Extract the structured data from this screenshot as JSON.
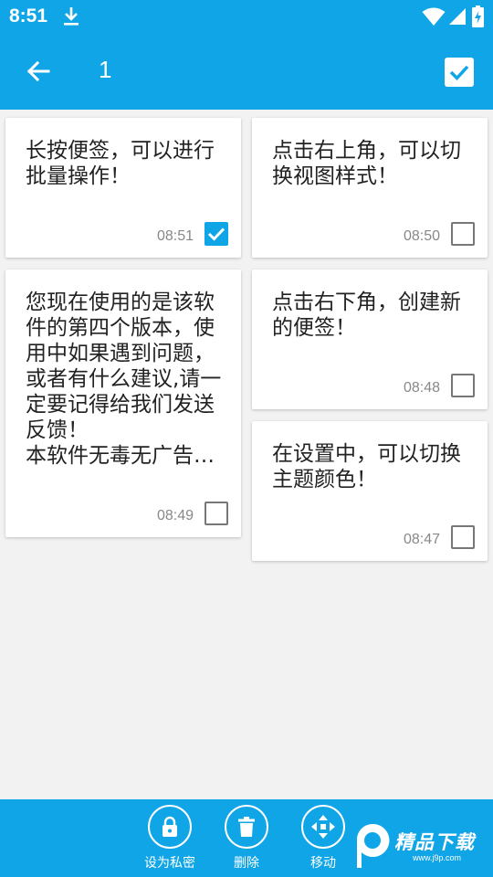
{
  "status_bar": {
    "time": "8:51"
  },
  "app_bar": {
    "selected_count": "1"
  },
  "notes": [
    {
      "text": "长按便签，可以进行批量操作！",
      "time": "08:51",
      "checked": true
    },
    {
      "text": "点击右上角，可以切换视图样式！",
      "time": "08:50",
      "checked": false
    },
    {
      "text": "您现在使用的是该软件的第四个版本，使用中如果遇到问题，或者有什么建议,请一定要记得给我们发送反馈！\n本软件无毒无广告…",
      "time": "08:49",
      "checked": false
    },
    {
      "text": "点击右下角，创建新的便签！",
      "time": "08:48",
      "checked": false
    },
    {
      "text": "在设置中，可以切换主题颜色！",
      "time": "08:47",
      "checked": false
    }
  ],
  "bottom_bar": {
    "actions": [
      {
        "label": "设为私密",
        "icon": "lock-icon"
      },
      {
        "label": "删除",
        "icon": "trash-icon"
      },
      {
        "label": "移动",
        "icon": "move-icon"
      }
    ]
  },
  "watermark": {
    "title": "精品下载",
    "url": "www.j9p.com"
  },
  "colors": {
    "primary": "#0fa5e6",
    "background": "#f2f2f2",
    "card": "#ffffff"
  }
}
